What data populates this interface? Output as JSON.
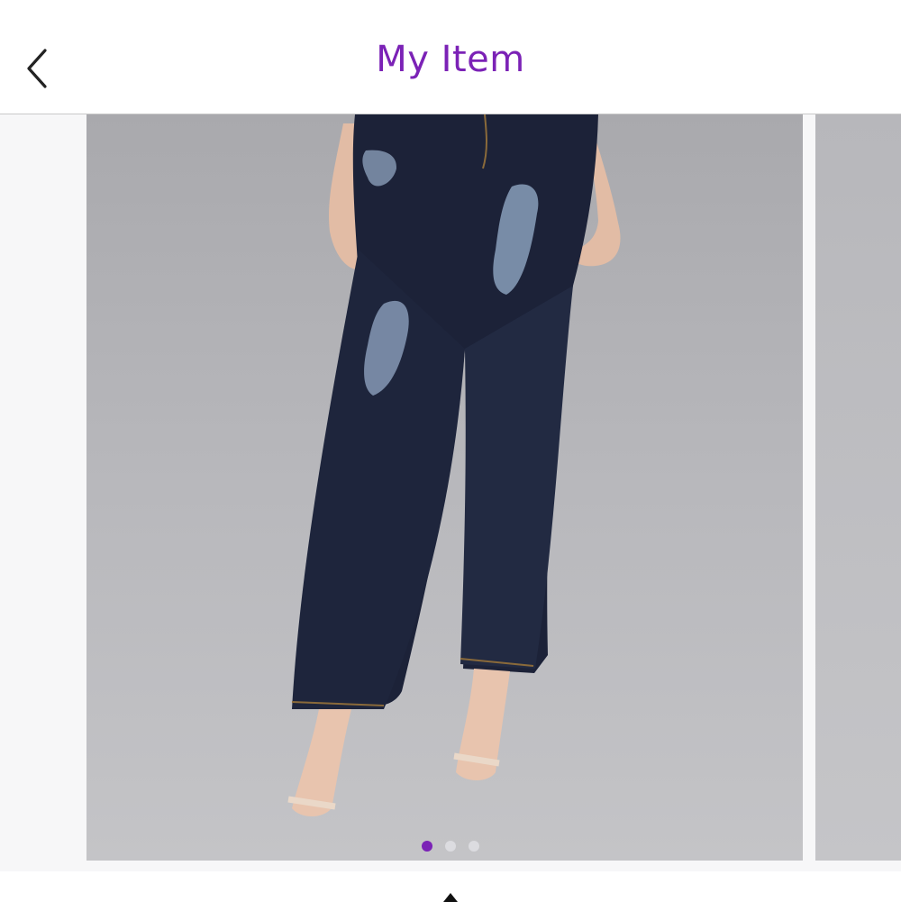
{
  "header": {
    "title": "My Item",
    "back_icon": "chevron-left-icon"
  },
  "colors": {
    "accent": "#7b22b6",
    "background": "#ffffff",
    "gallery_background": "#f7f7f8"
  },
  "gallery": {
    "slide_count": 3,
    "active_index": 0,
    "main_image": "product-photo-distressed-jeans",
    "next_image": "product-photo-next"
  },
  "bottom_bar": {
    "icon": "caret-up-icon"
  }
}
